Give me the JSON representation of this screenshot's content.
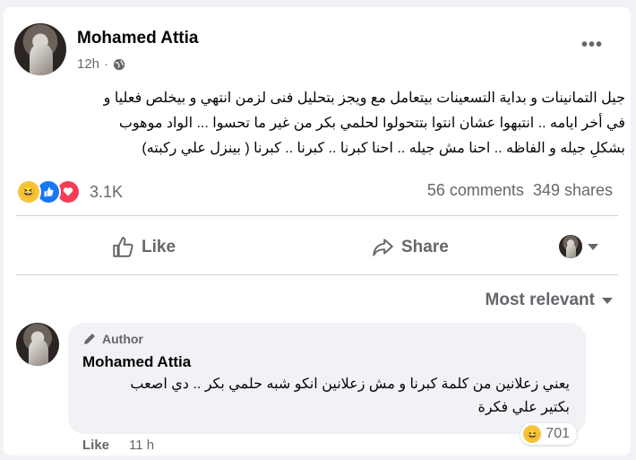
{
  "post": {
    "author": "Mohamed Attia",
    "time": "12h",
    "separator": "·",
    "privacy_icon": "globe-icon",
    "more_icon": "more-options-icon",
    "text_lines": [
      "جيل التمانينات و بداية التسعينات بيتعامل  مع ويجز بتحليل فنى  لزمن انتهي و بيخلص فعليا  و",
      "في أخر ايامه  ..  انتبهوا عشان انتوا بتتحولوا لحلمي بكر من غير ما تحسوا ... الواد موهوب",
      "بشكلِ جيله و الفاظه .. احنا مش جيله .. احنا كبرنا .. كبرنا .. كبرنا ( بينزل علي ركبته)"
    ]
  },
  "stats": {
    "reaction_icons": [
      "haha-icon",
      "like-icon",
      "love-icon"
    ],
    "reactions_count": "3.1K",
    "comments": "56 comments",
    "shares": "349 shares"
  },
  "actions": {
    "like": "Like",
    "share": "Share"
  },
  "sort": {
    "label": "Most relevant"
  },
  "comment": {
    "badge": "Author",
    "author": "Mohamed Attia",
    "text_lines": [
      "يعني زعلانين من كلمة كبرنا و مش زعلانين انكو شبه حلمي بكر .. دي اصعب",
      "بكتير علي فكرة"
    ],
    "reaction_count": "701",
    "like": "Like",
    "time": "11 h"
  },
  "colors": {
    "accent": "#1877f2",
    "love": "#f33e58",
    "haha": "#f7c33b",
    "secondary_text": "#65676b"
  }
}
